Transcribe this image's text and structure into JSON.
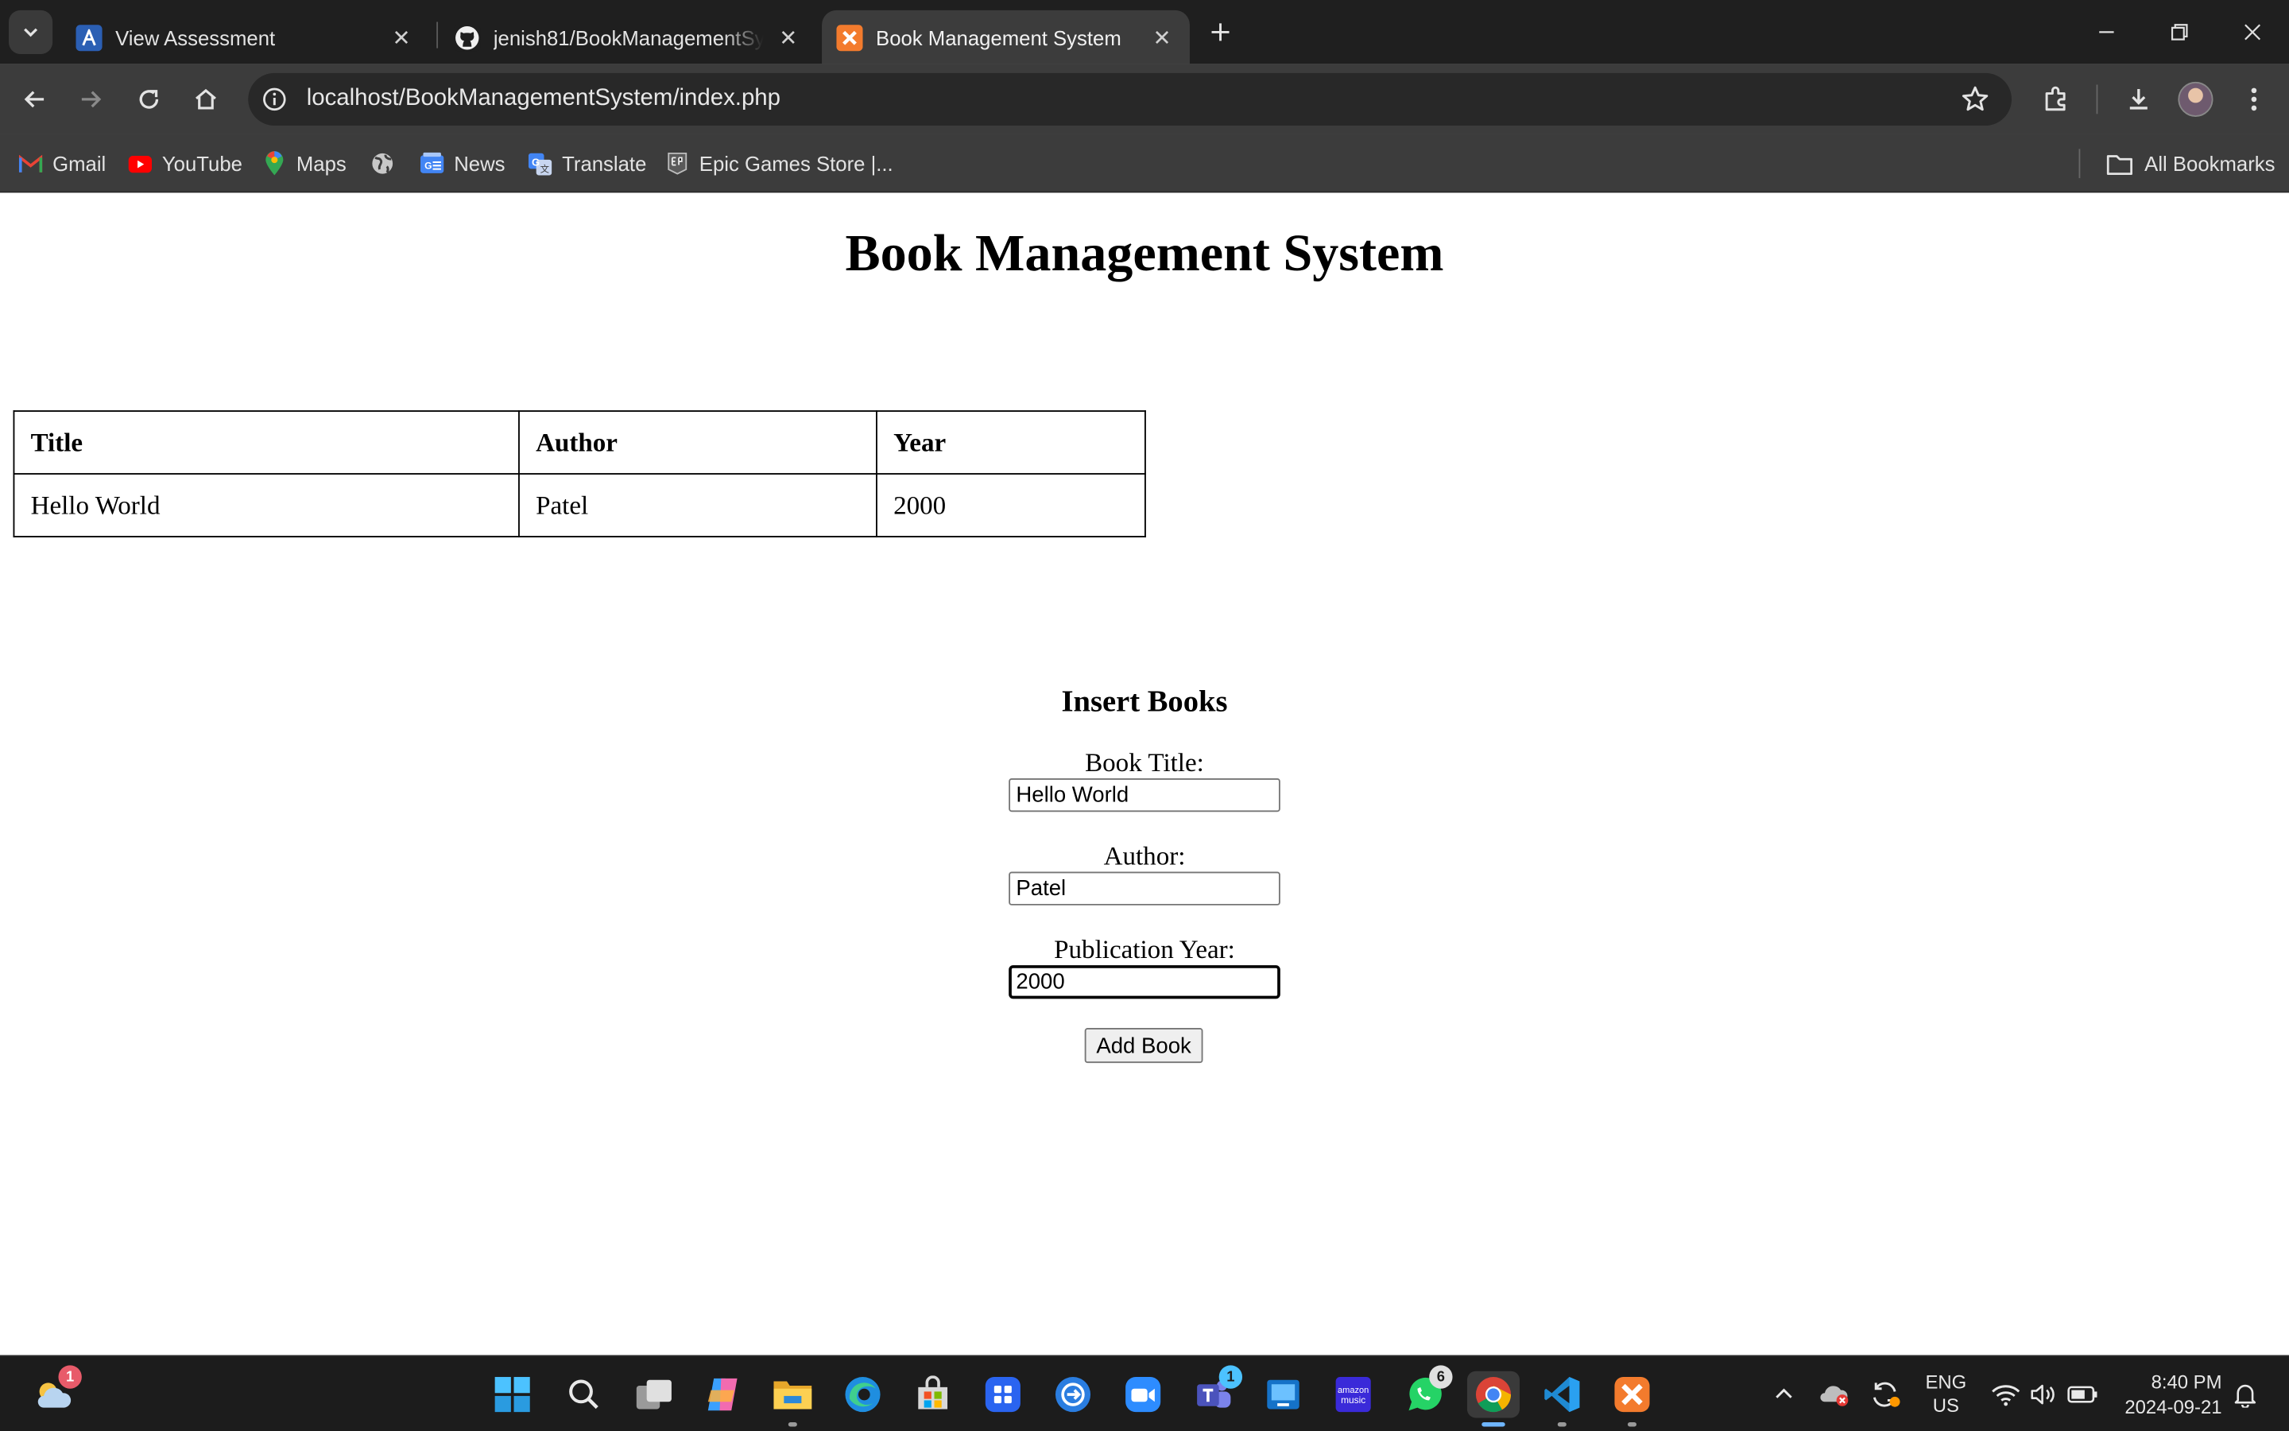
{
  "browser": {
    "tabs": [
      {
        "label": "View Assessment",
        "icon": "assessment-favicon-icon",
        "active": false
      },
      {
        "label": "jenish81/BookManagementSyst",
        "icon": "github-icon",
        "active": false
      },
      {
        "label": "Book Management System",
        "icon": "xampp-icon",
        "active": true
      }
    ],
    "url": "localhost/BookManagementSystem/index.php",
    "bookmarks": [
      {
        "label": "Gmail",
        "icon": "gmail-icon"
      },
      {
        "label": "YouTube",
        "icon": "youtube-icon"
      },
      {
        "label": "Maps",
        "icon": "maps-icon"
      },
      {
        "label": "",
        "icon": "globe-icon"
      },
      {
        "label": "News",
        "icon": "news-icon"
      },
      {
        "label": "Translate",
        "icon": "translate-icon"
      },
      {
        "label": "Epic Games Store |...",
        "icon": "epic-games-icon"
      }
    ],
    "all_bookmarks": "All Bookmarks",
    "colors": {
      "chrome_dark": "#1f1f1f",
      "toolbar": "#3c3c3c",
      "omnibox": "#282828"
    }
  },
  "page": {
    "heading": "Book Management System",
    "table": {
      "headers": [
        "Title",
        "Author",
        "Year"
      ],
      "rows": [
        [
          "Hello World",
          "Patel",
          "2000"
        ]
      ]
    },
    "form": {
      "title": "Insert Books",
      "title_label": "Book Title:",
      "title_value": "Hello World",
      "author_label": "Author:",
      "author_value": "Patel",
      "year_label": "Publication Year:",
      "year_value": "2000",
      "submit_label": "Add Book"
    }
  },
  "taskbar": {
    "apps": [
      {
        "name": "weather-widget",
        "badge": "1"
      },
      {
        "name": "start-button"
      },
      {
        "name": "search"
      },
      {
        "name": "task-view"
      },
      {
        "name": "copilot"
      },
      {
        "name": "file-explorer",
        "running": true
      },
      {
        "name": "edge"
      },
      {
        "name": "microsoft-store"
      },
      {
        "name": "app-launcher"
      },
      {
        "name": "remote-desktop"
      },
      {
        "name": "zoom"
      },
      {
        "name": "teams",
        "badge": "1"
      },
      {
        "name": "windows-app"
      },
      {
        "name": "amazon-music"
      },
      {
        "name": "whatsapp",
        "badge": "6"
      },
      {
        "name": "chrome",
        "running": true,
        "active": true
      },
      {
        "name": "vscode",
        "running": true
      },
      {
        "name": "xampp",
        "running": true
      }
    ],
    "lang_primary": "ENG",
    "lang_secondary": "US",
    "time": "8:40 PM",
    "date": "2024-09-21"
  }
}
